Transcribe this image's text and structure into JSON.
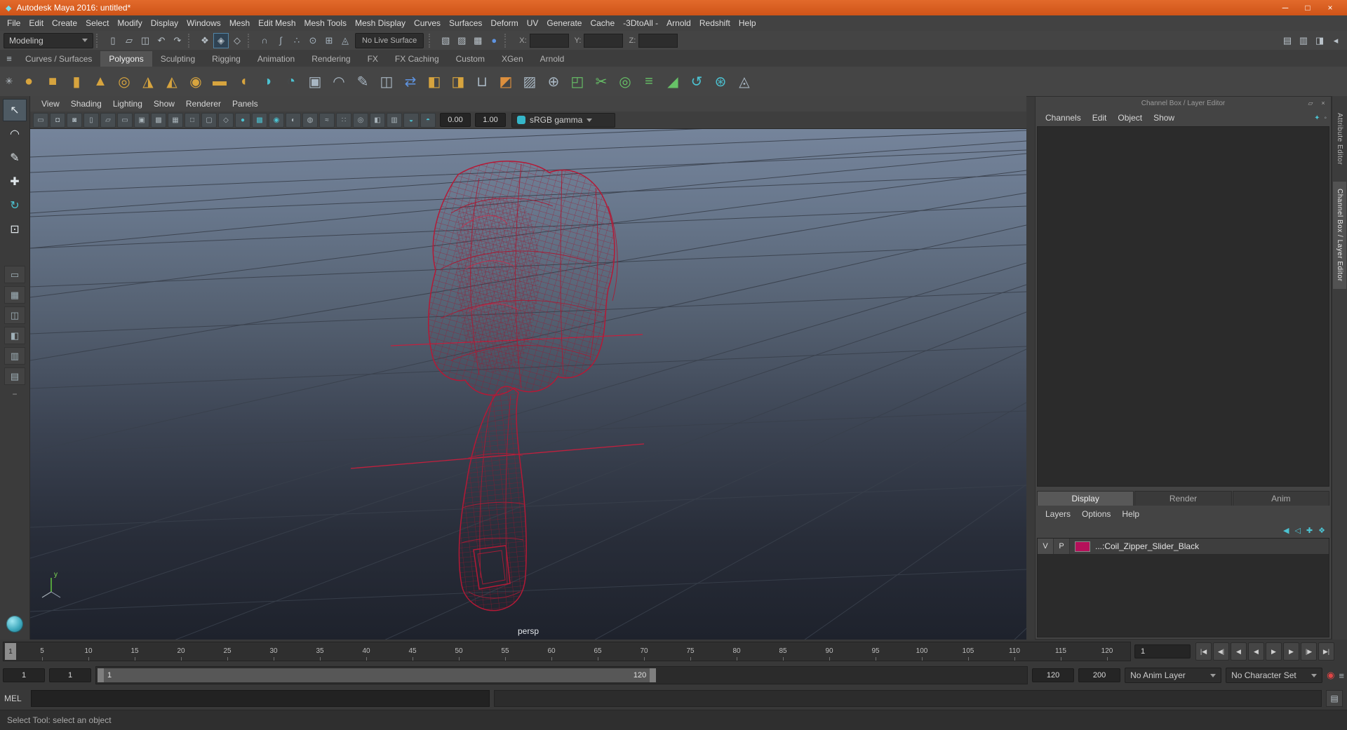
{
  "colors": {
    "titlebar": "#d4581d",
    "accent_blue": "#5285a6",
    "wireframe_red": "#b51936",
    "layer_swatch": "#b5105a",
    "viewport_top": "#75849b",
    "viewport_bottom": "#1e222c"
  },
  "title_bar": {
    "title": "Autodesk Maya 2016: untitled*",
    "window_buttons": [
      {
        "name": "minimize-button",
        "glyph": "─"
      },
      {
        "name": "maximize-button",
        "glyph": "□"
      },
      {
        "name": "close-button",
        "glyph": "×"
      }
    ]
  },
  "menu_bar": {
    "items": [
      "File",
      "Edit",
      "Create",
      "Select",
      "Modify",
      "Display",
      "Windows",
      "Mesh",
      "Edit Mesh",
      "Mesh Tools",
      "Mesh Display",
      "Curves",
      "Surfaces",
      "Deform",
      "UV",
      "Generate",
      "Cache",
      "-3DtoAll -",
      "Arnold",
      "Redshift",
      "Help"
    ]
  },
  "status_line": {
    "menu_set": "Modeling",
    "live_surface": "No Live Surface",
    "coords": {
      "x_label": "X:",
      "y_label": "Y:",
      "z_label": "Z:"
    },
    "file_icons": [
      {
        "name": "new-scene-icon",
        "glyph": "▯"
      },
      {
        "name": "open-scene-icon",
        "glyph": "▱"
      },
      {
        "name": "save-scene-icon",
        "glyph": "◫"
      },
      {
        "name": "undo-icon",
        "glyph": "↶"
      },
      {
        "name": "redo-icon",
        "glyph": "↷"
      }
    ],
    "selection_icons": [
      {
        "name": "hierarchy-mode-icon",
        "glyph": "❖"
      },
      {
        "name": "object-mode-icon",
        "glyph": "◈",
        "state": "active"
      },
      {
        "name": "component-mode-icon",
        "glyph": "◇"
      }
    ],
    "snap_icons": [
      {
        "name": "snap-grid-icon",
        "glyph": "∩",
        "tone": "slate"
      },
      {
        "name": "snap-curve-icon",
        "glyph": "∫",
        "tone": "slate"
      },
      {
        "name": "snap-point-icon",
        "glyph": "∴",
        "tone": "slate"
      },
      {
        "name": "snap-projected-center-icon",
        "glyph": "⊙",
        "tone": "slate"
      },
      {
        "name": "snap-view-plane-icon",
        "glyph": "⊞",
        "tone": "slate"
      },
      {
        "name": "make-live-icon",
        "glyph": "◬",
        "tone": "slate"
      }
    ],
    "render_icons": [
      {
        "name": "render-current-frame-icon",
        "glyph": "▧"
      },
      {
        "name": "ipr-render-icon",
        "glyph": "▨"
      },
      {
        "name": "render-settings-icon",
        "glyph": "▩"
      },
      {
        "name": "hypershade-icon",
        "glyph": "●",
        "tone": "blue"
      }
    ],
    "sidebar_icons": [
      {
        "name": "show-attribute-editor-icon",
        "glyph": "▤"
      },
      {
        "name": "show-tool-settings-icon",
        "glyph": "▥"
      },
      {
        "name": "show-channel-box-icon",
        "glyph": "◨"
      },
      {
        "name": "statusline-collapse-icon",
        "glyph": "◂"
      }
    ]
  },
  "shelf": {
    "menu_icon": "≡",
    "gear_icon": "✳",
    "tabs": [
      {
        "name": "shelf-tab-curves-surfaces",
        "label": "Curves / Surfaces"
      },
      {
        "name": "shelf-tab-polygons",
        "label": "Polygons",
        "state": "active"
      },
      {
        "name": "shelf-tab-sculpting",
        "label": "Sculpting"
      },
      {
        "name": "shelf-tab-rigging",
        "label": "Rigging"
      },
      {
        "name": "shelf-tab-animation",
        "label": "Animation"
      },
      {
        "name": "shelf-tab-rendering",
        "label": "Rendering"
      },
      {
        "name": "shelf-tab-fx",
        "label": "FX"
      },
      {
        "name": "shelf-tab-fx-caching",
        "label": "FX Caching"
      },
      {
        "name": "shelf-tab-custom",
        "label": "Custom"
      },
      {
        "name": "shelf-tab-xgen",
        "label": "XGen"
      },
      {
        "name": "shelf-tab-arnold",
        "label": "Arnold"
      }
    ],
    "icons": [
      {
        "name": "poly-sphere-icon",
        "glyph": "●",
        "tone": "gold"
      },
      {
        "name": "poly-cube-icon",
        "glyph": "■",
        "tone": "gold"
      },
      {
        "name": "poly-cylinder-icon",
        "glyph": "▮",
        "tone": "gold"
      },
      {
        "name": "poly-cone-icon",
        "glyph": "▲",
        "tone": "gold"
      },
      {
        "name": "poly-torus-icon",
        "glyph": "◎",
        "tone": "gold"
      },
      {
        "name": "poly-pyramid-icon",
        "glyph": "◮",
        "tone": "gold"
      },
      {
        "name": "poly-prism-icon",
        "glyph": "◭",
        "tone": "gold"
      },
      {
        "name": "poly-pipe-icon",
        "glyph": "◉",
        "tone": "gold"
      },
      {
        "name": "poly-plane-icon",
        "glyph": "▬",
        "tone": "gold"
      },
      {
        "name": "poly-disc-icon",
        "glyph": "◖",
        "tone": "gold"
      },
      {
        "name": "smooth-mesh-icon",
        "glyph": "◑",
        "tone": "teal"
      },
      {
        "name": "subdiv-proxy-icon",
        "glyph": "◔",
        "tone": "teal"
      },
      {
        "name": "poly-text-icon",
        "glyph": "▣",
        "tone": "slate"
      },
      {
        "name": "sweep-mesh-icon",
        "glyph": "◠",
        "tone": "slate"
      },
      {
        "name": "pencil-curve-icon",
        "glyph": "✎",
        "tone": "slate"
      },
      {
        "name": "quad-strip-icon",
        "glyph": "◫",
        "tone": "slate"
      },
      {
        "name": "transfer-attributes-icon",
        "glyph": "⇄",
        "tone": "blue"
      },
      {
        "name": "combine-icon",
        "glyph": "◧",
        "tone": "gold"
      },
      {
        "name": "separate-icon",
        "glyph": "◨",
        "tone": "gold"
      },
      {
        "name": "extrude-icon",
        "glyph": "⊔",
        "tone": "slate"
      },
      {
        "name": "bevel-icon",
        "glyph": "◩",
        "tone": "orange"
      },
      {
        "name": "bridge-icon",
        "glyph": "▨",
        "tone": "slate"
      },
      {
        "name": "boolean-union-icon",
        "glyph": "⊕",
        "tone": "slate"
      },
      {
        "name": "quad-draw-icon",
        "glyph": "◰",
        "tone": "green"
      },
      {
        "name": "multi-cut-icon",
        "glyph": "✂",
        "tone": "green"
      },
      {
        "name": "target-weld-icon",
        "glyph": "◎",
        "tone": "green"
      },
      {
        "name": "connect-icon",
        "glyph": "≡",
        "tone": "green"
      },
      {
        "name": "crease-icon",
        "glyph": "◢",
        "tone": "green"
      },
      {
        "name": "spin-edge-icon",
        "glyph": "↺",
        "tone": "teal"
      },
      {
        "name": "symmetrize-icon",
        "glyph": "⊛",
        "tone": "teal"
      },
      {
        "name": "mirror-icon",
        "glyph": "◬",
        "tone": "slate"
      }
    ]
  },
  "toolbox": {
    "tools": [
      {
        "name": "select-tool",
        "glyph": "↖",
        "tone": "light",
        "state": "active"
      },
      {
        "name": "lasso-tool",
        "glyph": "◠",
        "tone": "light"
      },
      {
        "name": "paint-selection-tool",
        "glyph": "✎",
        "tone": "light"
      },
      {
        "name": "move-tool",
        "glyph": "✚",
        "tone": "light"
      },
      {
        "name": "rotate-tool",
        "glyph": "↻",
        "tone": "teal"
      },
      {
        "name": "scale-tool",
        "glyph": "⊡",
        "tone": "light"
      }
    ],
    "layouts": [
      {
        "name": "quick-layout-single-button",
        "glyph": "▭"
      },
      {
        "name": "quick-layout-four-button",
        "glyph": "▦"
      },
      {
        "name": "quick-layout-split-button",
        "glyph": "◫"
      },
      {
        "name": "quick-layout-outliner-button",
        "glyph": "◧"
      },
      {
        "name": "quick-layout-graph-button",
        "glyph": "▥"
      },
      {
        "name": "quick-layout-hypershade-button",
        "glyph": "▤"
      }
    ],
    "collapse_glyph": "−"
  },
  "viewport": {
    "menus": [
      "View",
      "Shading",
      "Lighting",
      "Show",
      "Renderer",
      "Panels"
    ],
    "toolbar_icons": [
      {
        "name": "select-camera-icon",
        "glyph": "▭",
        "tone": "dim"
      },
      {
        "name": "lock-camera-icon",
        "glyph": "◘",
        "tone": "dim"
      },
      {
        "name": "camera-attributes-icon",
        "glyph": "◙",
        "tone": "dim"
      },
      {
        "name": "bookmarks-icon",
        "glyph": "▯",
        "tone": "dim"
      },
      {
        "name": "image-plane-icon",
        "glyph": "▱",
        "tone": "dim"
      },
      {
        "name": "film-gate-icon",
        "glyph": "▭",
        "tone": "dim"
      },
      {
        "name": "resolution-gate-icon",
        "glyph": "▣",
        "tone": "dim"
      },
      {
        "name": "gate-mask-icon",
        "glyph": "▩",
        "tone": "dim"
      },
      {
        "name": "field-chart-icon",
        "glyph": "▦",
        "tone": "dim"
      },
      {
        "name": "safe-action-icon",
        "glyph": "□",
        "tone": "dim"
      },
      {
        "name": "safe-title-icon",
        "glyph": "▢",
        "tone": "dim"
      },
      {
        "name": "wireframe-icon",
        "glyph": "◇",
        "tone": "dim"
      },
      {
        "name": "smooth-shade-icon",
        "glyph": "●",
        "tone": "teal"
      },
      {
        "name": "textured-icon",
        "glyph": "▩",
        "tone": "teal"
      },
      {
        "name": "use-all-lights-icon",
        "glyph": "◉",
        "tone": "teal"
      },
      {
        "name": "shadows-icon",
        "glyph": "◐",
        "tone": "dim"
      },
      {
        "name": "ao-icon",
        "glyph": "◍",
        "tone": "dim"
      },
      {
        "name": "motion-blur-icon",
        "glyph": "≈",
        "tone": "dim"
      },
      {
        "name": "multisample-icon",
        "glyph": "∷",
        "tone": "dim"
      },
      {
        "name": "depth-of-field-icon",
        "glyph": "◎",
        "tone": "dim"
      },
      {
        "name": "isolate-select-icon",
        "glyph": "◧",
        "tone": "dim"
      },
      {
        "name": "xray-icon",
        "glyph": "▥",
        "tone": "dim"
      },
      {
        "name": "exposure-icon",
        "glyph": "◒",
        "tone": "teal"
      },
      {
        "name": "gamma-icon",
        "glyph": "◓",
        "tone": "teal"
      }
    ],
    "exposure": "0.00",
    "gamma": "1.00",
    "view_transform": "sRGB gamma",
    "camera_label": "persp"
  },
  "channel_box": {
    "header": "Channel Box / Layer Editor",
    "header_icons": [
      {
        "name": "panel-popout-icon",
        "glyph": "▱"
      },
      {
        "name": "panel-close-icon",
        "glyph": "×"
      }
    ],
    "menus": [
      "Channels",
      "Edit",
      "Object",
      "Show"
    ],
    "menu_icons": [
      {
        "name": "manipulator-icon",
        "glyph": "✦",
        "tone": "teal"
      },
      {
        "name": "speed-settings-icon",
        "glyph": "◦",
        "tone": "dim"
      }
    ]
  },
  "layer_editor": {
    "tabs": [
      {
        "name": "layer-tab-display",
        "label": "Display",
        "state": "active"
      },
      {
        "name": "layer-tab-render",
        "label": "Render"
      },
      {
        "name": "layer-tab-anim",
        "label": "Anim"
      }
    ],
    "menus": [
      "Layers",
      "Options",
      "Help"
    ],
    "icons": [
      {
        "name": "layer-sync-icon",
        "glyph": "◀",
        "tone": "teal"
      },
      {
        "name": "layer-unsync-icon",
        "glyph": "◁",
        "tone": "teal"
      },
      {
        "name": "create-empty-layer-icon",
        "glyph": "✚",
        "tone": "teal"
      },
      {
        "name": "create-layer-from-selected-icon",
        "glyph": "❖",
        "tone": "teal"
      }
    ],
    "layers": [
      {
        "v": "V",
        "p": "P",
        "layer_name": "...:Coil_Zipper_Slider_Black"
      }
    ]
  },
  "side_tabs": [
    {
      "name": "tab-attribute-editor",
      "label": "Attribute Editor"
    },
    {
      "name": "tab-channel-box-layer-editor",
      "label": "Channel Box / Layer Editor",
      "state": "active"
    }
  ],
  "time_slider": {
    "current_frame": "1",
    "ticks": [
      "5",
      "10",
      "15",
      "20",
      "25",
      "30",
      "35",
      "40",
      "45",
      "50",
      "55",
      "60",
      "65",
      "70",
      "75",
      "80",
      "85",
      "90",
      "95",
      "100",
      "105",
      "110",
      "115",
      "120"
    ],
    "frame_field": "1",
    "playback": [
      {
        "name": "go-to-start-button",
        "glyph": "|◀"
      },
      {
        "name": "step-back-key-button",
        "glyph": "◀|"
      },
      {
        "name": "step-back-frame-button",
        "glyph": "◀"
      },
      {
        "name": "play-backwards-button",
        "glyph": "◀"
      },
      {
        "name": "play-forwards-button",
        "glyph": "▶"
      },
      {
        "name": "step-forward-frame-button",
        "glyph": "▶"
      },
      {
        "name": "step-forward-key-button",
        "glyph": "|▶"
      },
      {
        "name": "go-to-end-button",
        "glyph": "▶|"
      }
    ]
  },
  "range_slider": {
    "anim_start": "1",
    "playback_start": "1",
    "bar_start_label": "1",
    "bar_end_label": "120",
    "playback_end": "120",
    "anim_end": "200",
    "anim_layer": "No Anim Layer",
    "character_set": "No Character Set",
    "icons": [
      {
        "name": "auto-keyframe-icon",
        "glyph": "◉",
        "tone": "red"
      },
      {
        "name": "animation-preferences-icon",
        "glyph": "≡",
        "tone": "dim"
      }
    ]
  },
  "command_line": {
    "label": "MEL",
    "icon": "▤"
  },
  "help_line": {
    "text": "Select Tool: select an object"
  }
}
